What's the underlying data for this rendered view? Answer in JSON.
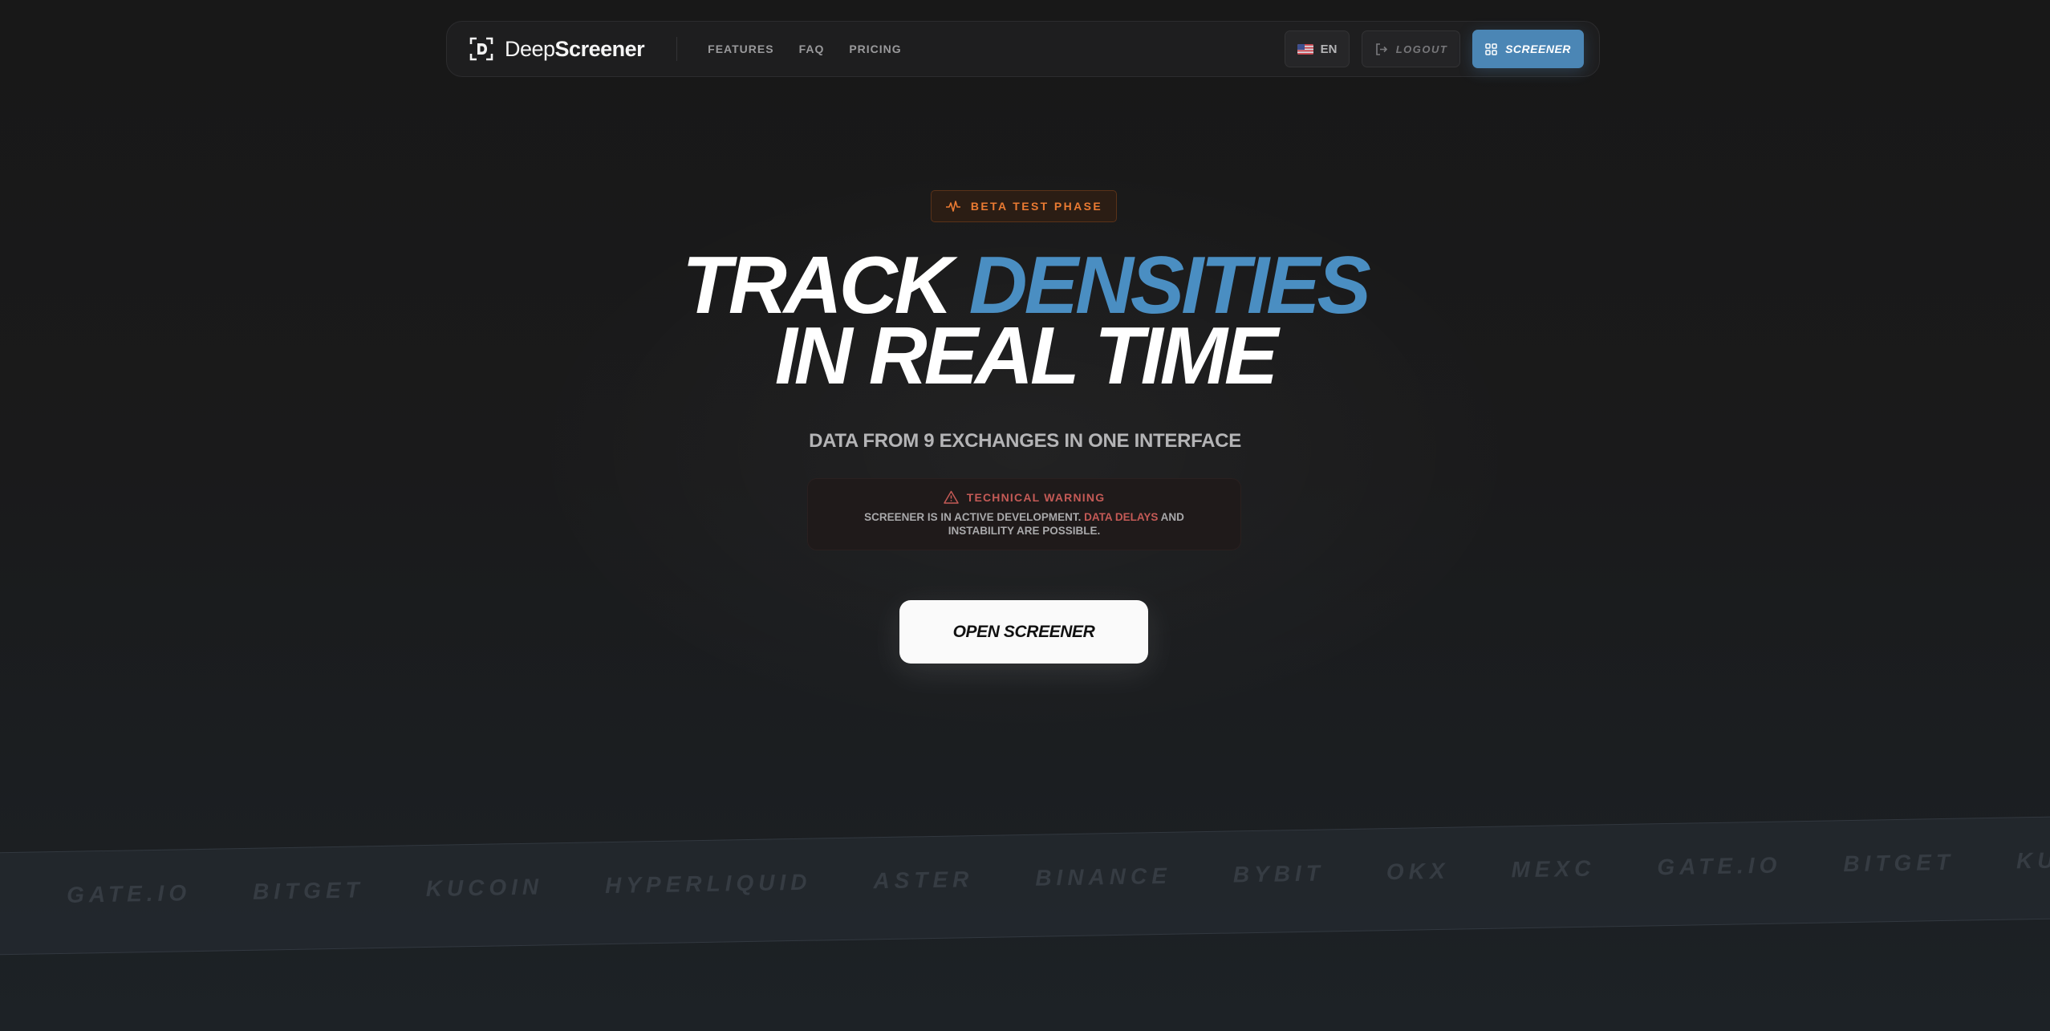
{
  "brand": {
    "name_light": "Deep",
    "name_bold": "Screener",
    "logo_icon": "deepscreener-logo-icon"
  },
  "nav": {
    "links": [
      "FEATURES",
      "FAQ",
      "PRICING"
    ]
  },
  "header_actions": {
    "language": {
      "label": "EN",
      "icon": "us-flag-icon"
    },
    "logout_label": "LOGOUT",
    "screener_label": "SCREENER"
  },
  "hero": {
    "badge": "BETA TEST PHASE",
    "headline_part1": "TRACK",
    "headline_accent": "DENSITIES",
    "headline_line2": "IN REAL TIME",
    "subheadline": "DATA FROM 9 EXCHANGES IN ONE INTERFACE",
    "warning": {
      "title": "TECHNICAL WARNING",
      "text_before": "SCREENER IS IN ACTIVE DEVELOPMENT.",
      "text_highlight": "DATA DELAYS",
      "text_after": "AND INSTABILITY ARE POSSIBLE."
    },
    "cta_label": "OPEN SCREENER"
  },
  "exchanges": [
    "GATE.IO",
    "BITGET",
    "KUCOIN",
    "HYPERLIQUID",
    "ASTER",
    "BINANCE",
    "BYBIT",
    "OKX",
    "MEXC",
    "GATE.IO",
    "BITGET",
    "KUCOIN"
  ],
  "colors": {
    "background": "#171718",
    "accent_blue": "#4a8ec2",
    "screener_button": "#4b86b5",
    "beta_orange": "#ea7a32",
    "warning_red": "#c45a56"
  }
}
